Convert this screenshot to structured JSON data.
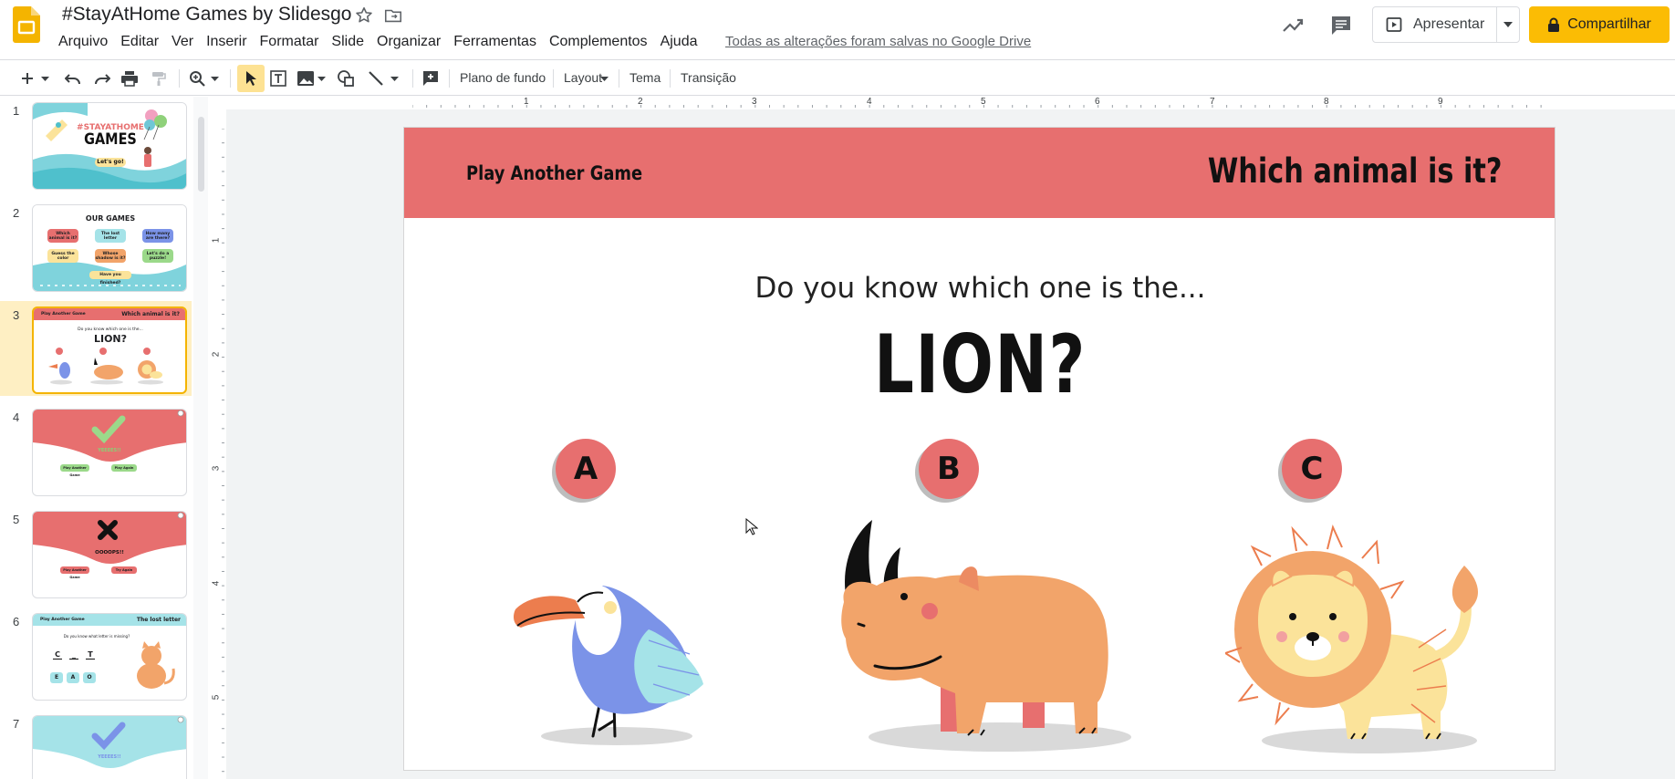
{
  "app": {
    "doc_title": "#StayAtHome Games by Slidesgo",
    "menu": [
      "Arquivo",
      "Editar",
      "Ver",
      "Inserir",
      "Formatar",
      "Slide",
      "Organizar",
      "Ferramentas",
      "Complementos",
      "Ajuda"
    ],
    "save_status": "Todas as alterações foram salvas no Google Drive",
    "present_label": "Apresentar",
    "share_label": "Compartilhar",
    "brand_color": "#f4b400",
    "share_color": "#fbbc04"
  },
  "toolbar": {
    "background_label": "Plano de fundo",
    "layout_label": "Layout",
    "theme_label": "Tema",
    "transition_label": "Transição"
  },
  "filmstrip": {
    "slides": [
      {
        "number": "1",
        "kind": "title",
        "title_line1": "#STAYATHOME",
        "title_line2": "GAMES",
        "button": "Let's go!"
      },
      {
        "number": "2",
        "kind": "menu",
        "heading": "OUR GAMES",
        "items": [
          "Which animal is it?",
          "The lost letter",
          "How many are there?",
          "Guess the color",
          "Whose shadow is it?",
          "Let's do a puzzle!"
        ],
        "footer": "Have you finished?"
      },
      {
        "number": "3",
        "kind": "game",
        "left": "Play Another Game",
        "right": "Which animal is it?",
        "question": "Do you know which one is the...",
        "answer": "LION?"
      },
      {
        "number": "4",
        "kind": "correct",
        "text": "YEEEES!!",
        "buttons": [
          "Play Another Game",
          "Play Again"
        ]
      },
      {
        "number": "5",
        "kind": "wrong",
        "text": "OOOOPS!!",
        "buttons": [
          "Play Another Game",
          "Try Again"
        ]
      },
      {
        "number": "6",
        "kind": "letter",
        "left": "Play Another Game",
        "right": "The lost letter",
        "question": "Do you know what letter is missing?",
        "word": [
          "C",
          "_",
          "T"
        ],
        "options": [
          "E",
          "A",
          "O"
        ]
      },
      {
        "number": "7",
        "kind": "correct-blue",
        "text": "YEEEES!!"
      }
    ]
  },
  "rulers": {
    "h_numbers": [
      "1",
      "2",
      "3",
      "4",
      "5",
      "6",
      "7",
      "8",
      "9"
    ],
    "v_numbers": [
      "1",
      "2",
      "3",
      "4",
      "5"
    ]
  },
  "slide": {
    "left_link": "Play Another Game",
    "title": "Which animal is it?",
    "question": "Do you know which one is the...",
    "answer": "LION?",
    "options": [
      "A",
      "B",
      "C"
    ],
    "animals": [
      "toucan",
      "rhino",
      "lion"
    ],
    "banner_color": "#e76f6f"
  }
}
